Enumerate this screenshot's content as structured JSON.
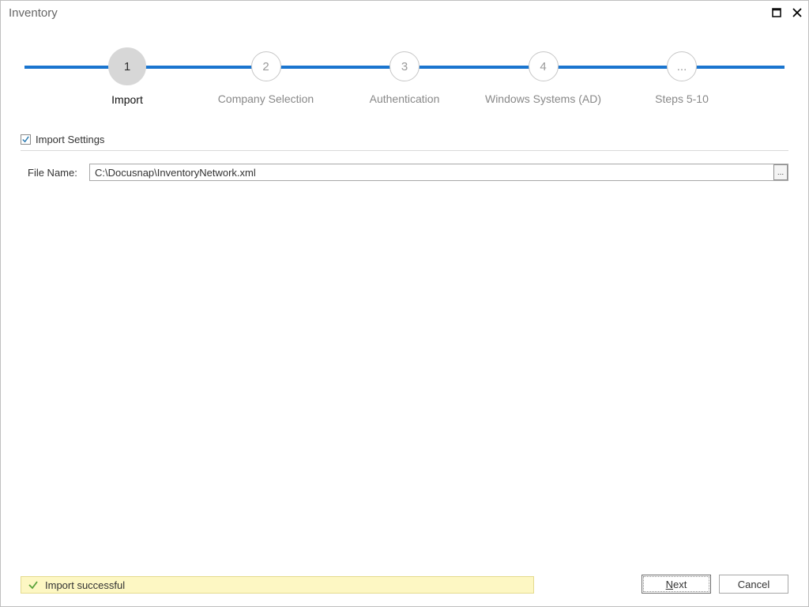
{
  "window": {
    "title": "Inventory"
  },
  "steps": [
    {
      "num": "1",
      "label": "Import",
      "active": true
    },
    {
      "num": "2",
      "label": "Company Selection",
      "active": false
    },
    {
      "num": "3",
      "label": "Authentication",
      "active": false
    },
    {
      "num": "4",
      "label": "Windows Systems (AD)",
      "active": false
    },
    {
      "num": "...",
      "label": "Steps 5-10",
      "active": false
    }
  ],
  "section": {
    "checked": true,
    "label": "Import Settings"
  },
  "file": {
    "label": "File Name:",
    "value": "C:\\Docusnap\\InventoryNetwork.xml",
    "browse_glyph": "..."
  },
  "status": {
    "text": "Import successful"
  },
  "buttons": {
    "next_prefix": "N",
    "next_rest": "ext",
    "cancel": "Cancel"
  }
}
